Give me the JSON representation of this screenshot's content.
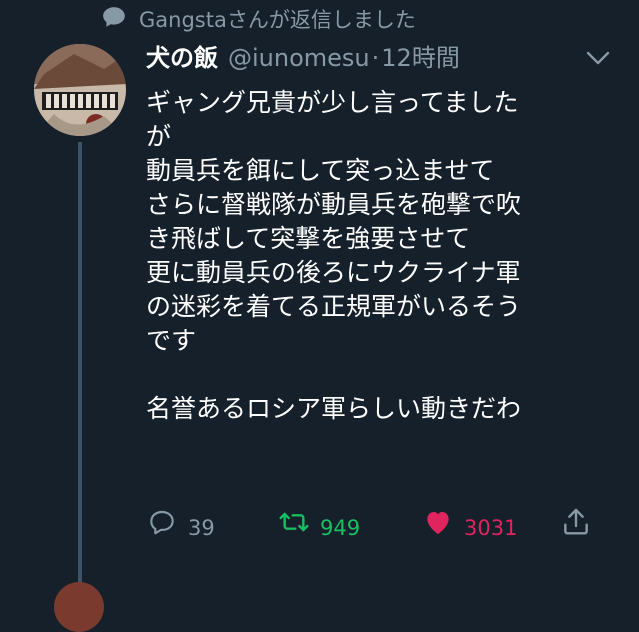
{
  "reply_context": {
    "icon": "speech-bubble-icon",
    "text": "Gangstaさんが返信しました"
  },
  "tweet": {
    "display_name": "犬の飯",
    "handle": "@iunomesu",
    "separator": "·",
    "time": "12時間",
    "text": "ギャング兄貴が少し言ってました\nが\n動員兵を餌にして突っ込ませて\nさらに督戦隊が動員兵を砲撃で吹\nき飛ばして突撃を強要させて\n更に動員兵の後ろにウクライナ軍\nの迷彩を着てる正規軍がいるそう\nです\n\n名誉あるロシア軍らしい動きだわ",
    "menu_icon": "chevron-down-icon"
  },
  "actions": {
    "reply_count": "39",
    "retweet_count": "949",
    "like_count": "3031",
    "share_icon": "share-icon"
  },
  "colors": {
    "background": "#15202b",
    "secondary_text": "#8899a6",
    "retweet_active": "#17bf63",
    "like_active": "#e0245e",
    "thread_line": "#3d5466"
  }
}
